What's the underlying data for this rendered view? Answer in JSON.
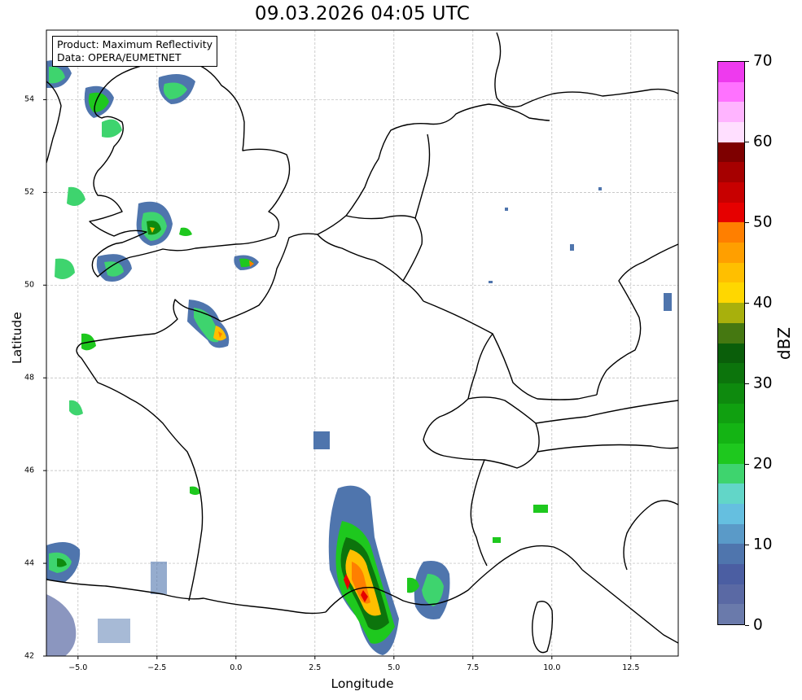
{
  "title": "09.03.2026 04:05 UTC",
  "info_box": {
    "line1": "Product: Maximum Reflectivity",
    "line2": "Data: OPERA/EUMETNET"
  },
  "axes": {
    "xlabel": "Longitude",
    "ylabel": "Latitude",
    "xlim": [
      -6,
      14
    ],
    "ylim": [
      42,
      55.5
    ],
    "xticks": [
      "−5.0",
      "−2.5",
      "0.0",
      "2.5",
      "5.0",
      "7.5",
      "10.0",
      "12.5"
    ],
    "xtick_values": [
      -5,
      -2.5,
      0,
      2.5,
      5,
      7.5,
      10,
      12.5
    ],
    "yticks": [
      "42",
      "44",
      "46",
      "48",
      "50",
      "52",
      "54"
    ],
    "ytick_values": [
      42,
      44,
      46,
      48,
      50,
      52,
      54
    ],
    "grid": true
  },
  "colorbar": {
    "label": "dBZ",
    "ticks": [
      "0",
      "10",
      "20",
      "30",
      "40",
      "50",
      "60",
      "70"
    ],
    "tick_values": [
      0,
      10,
      20,
      30,
      40,
      50,
      60,
      70
    ],
    "min": 0,
    "max": 70,
    "colors": [
      "#6a7aab",
      "#5a69a4",
      "#4b5ea2",
      "#4f75ad",
      "#5a9ac8",
      "#65bfe0",
      "#62d6c8",
      "#3ed46e",
      "#1ec81e",
      "#14b414",
      "#10a010",
      "#0e8a0e",
      "#0c740c",
      "#0a5e0a",
      "#457811",
      "#a8b00c",
      "#ffd700",
      "#ffbf00",
      "#ff9f00",
      "#ff7f00",
      "#e60000",
      "#c80000",
      "#a60000",
      "#7e0000",
      "#ffdfff",
      "#ffb4ff",
      "#ff72ff",
      "#ee3aee"
    ]
  },
  "chart_data": {
    "type": "map",
    "title": "09.03.2026 04:05 UTC",
    "region": "Western Europe (France, Benelux, Germany, Alps, southern England)",
    "precip_cells": [
      {
        "lon": 4.0,
        "lat": 43.5,
        "max_dbz": 50
      },
      {
        "lon": -2.3,
        "lat": 51.2,
        "max_dbz": 32
      },
      {
        "lon": 0.6,
        "lat": 50.5,
        "max_dbz": 38
      },
      {
        "lon": -0.6,
        "lat": 48.9,
        "max_dbz": 42
      },
      {
        "lon": -4.4,
        "lat": 54.0,
        "max_dbz": 28
      },
      {
        "lon": -5.2,
        "lat": 50.1,
        "max_dbz": 22
      },
      {
        "lon": -5.5,
        "lat": 44.1,
        "max_dbz": 28
      },
      {
        "lon": 6.3,
        "lat": 43.5,
        "max_dbz": 25
      },
      {
        "lon": 3.2,
        "lat": 44.9,
        "max_dbz": 20
      },
      {
        "lon": 2.8,
        "lat": 46.8,
        "max_dbz": 10
      }
    ]
  }
}
